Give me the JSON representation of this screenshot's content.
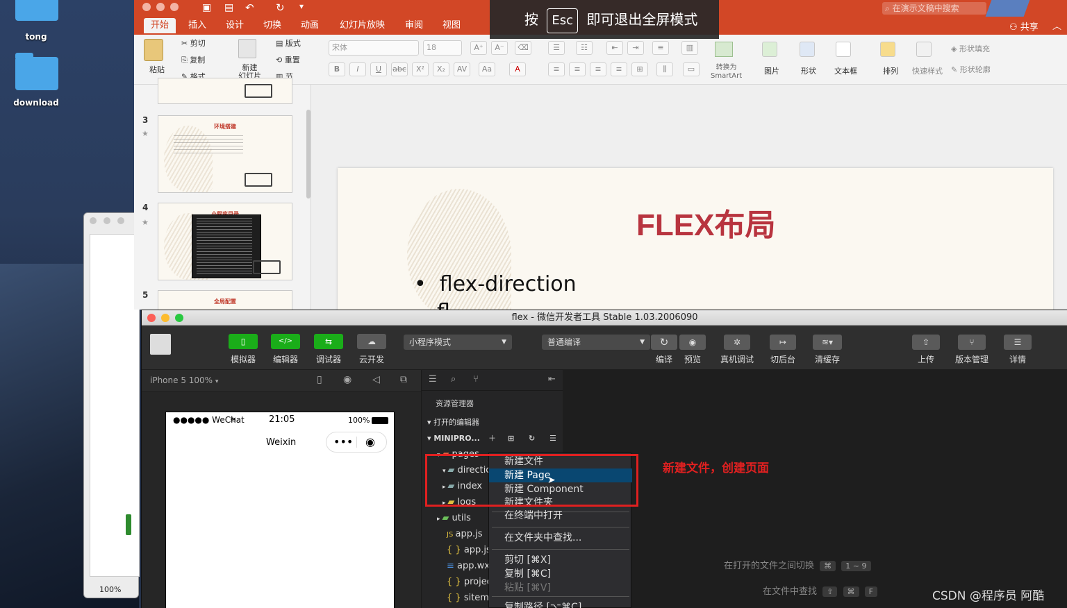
{
  "desktop": {
    "folders": [
      {
        "label": "tong"
      },
      {
        "label": "download"
      }
    ],
    "preview_zoom": "100%"
  },
  "powerpoint": {
    "search_placeholder": "在演示文稿中搜索",
    "share_label": "共享",
    "tabs": [
      "开始",
      "插入",
      "设计",
      "切换",
      "动画",
      "幻灯片放映",
      "审阅",
      "视图"
    ],
    "ribbon": {
      "paste": "粘贴",
      "cut": "剪切",
      "copy": "复制",
      "format": "格式",
      "new_slide": "新建\n幻灯片",
      "layout": "版式",
      "reset": "重置",
      "section": "节",
      "font_name": "宋体",
      "font_size": "18",
      "convert_smartart": "转换为\nSmartArt",
      "picture": "图片",
      "shape": "形状",
      "textbox": "文本框",
      "arrange": "排列",
      "quick_styles": "快速样式",
      "shape_fill": "形状填充",
      "shape_outline": "形状轮廓"
    },
    "thumbnails": [
      {
        "number": "3",
        "title": "环境搭建"
      },
      {
        "number": "4",
        "title": "小程序目录"
      },
      {
        "number": "5",
        "title": "全局配置"
      }
    ],
    "slide": {
      "title": "FLEX布局",
      "bullet": "flex-direction",
      "bullet2": "fl"
    },
    "fullscreen_banner": {
      "prefix": "按",
      "key": "Esc",
      "suffix": "即可退出全屏模式"
    }
  },
  "devtools": {
    "window_title": "flex - 微信开发者工具 Stable 1.03.2006090",
    "toolbar": {
      "simulator": "模拟器",
      "editor": "编辑器",
      "debugger": "调试器",
      "cloud": "云开发",
      "mode": "小程序模式",
      "compile_mode": "普通编译",
      "compile": "编译",
      "preview": "预览",
      "real_debug": "真机调试",
      "background": "切后台",
      "clear_cache": "清缓存",
      "upload": "上传",
      "version": "版本管理",
      "details": "详情"
    },
    "device": "iPhone 5 100%",
    "phone": {
      "carrier": "●●●●● WeChat",
      "time": "21:05",
      "battery": "100%",
      "nav_title": "Weixin",
      "menu_dots": "•••"
    },
    "explorer": {
      "title": "资源管理器",
      "open_editors": "打开的编辑器",
      "project": "MINIPRO...",
      "tree": [
        {
          "name": "pages",
          "indent": 1
        },
        {
          "name": "direction",
          "indent": 2
        },
        {
          "name": "index",
          "indent": 2
        },
        {
          "name": "logs",
          "indent": 2
        },
        {
          "name": "utils",
          "indent": 1
        },
        {
          "name": "app.js",
          "indent": 1
        },
        {
          "name": "app.json",
          "indent": 1
        },
        {
          "name": "app.wxss",
          "indent": 1
        },
        {
          "name": "project.config.json",
          "indent": 1
        },
        {
          "name": "sitemap.json",
          "indent": 1
        }
      ]
    },
    "context_menu": {
      "items": [
        "新建文件",
        "新建 Page",
        "新建 Component",
        "新建文件夹",
        "在终端中打开",
        "在文件夹中查找...",
        "剪切 [⌘X]",
        "复制 [⌘C]",
        "粘贴 [⌘V]",
        "复制路径 [⌥⌘C]"
      ],
      "selected": "新建 Page"
    },
    "hints": [
      {
        "text": "在打开的文件之间切换",
        "keys": [
          "⌘",
          "1 ~ 9"
        ]
      },
      {
        "text": "在文件中查找",
        "keys": [
          "⇧",
          "⌘",
          "F"
        ]
      }
    ]
  },
  "annotation": "新建文件，创建页面",
  "watermark": "CSDN @程序员 阿酷"
}
